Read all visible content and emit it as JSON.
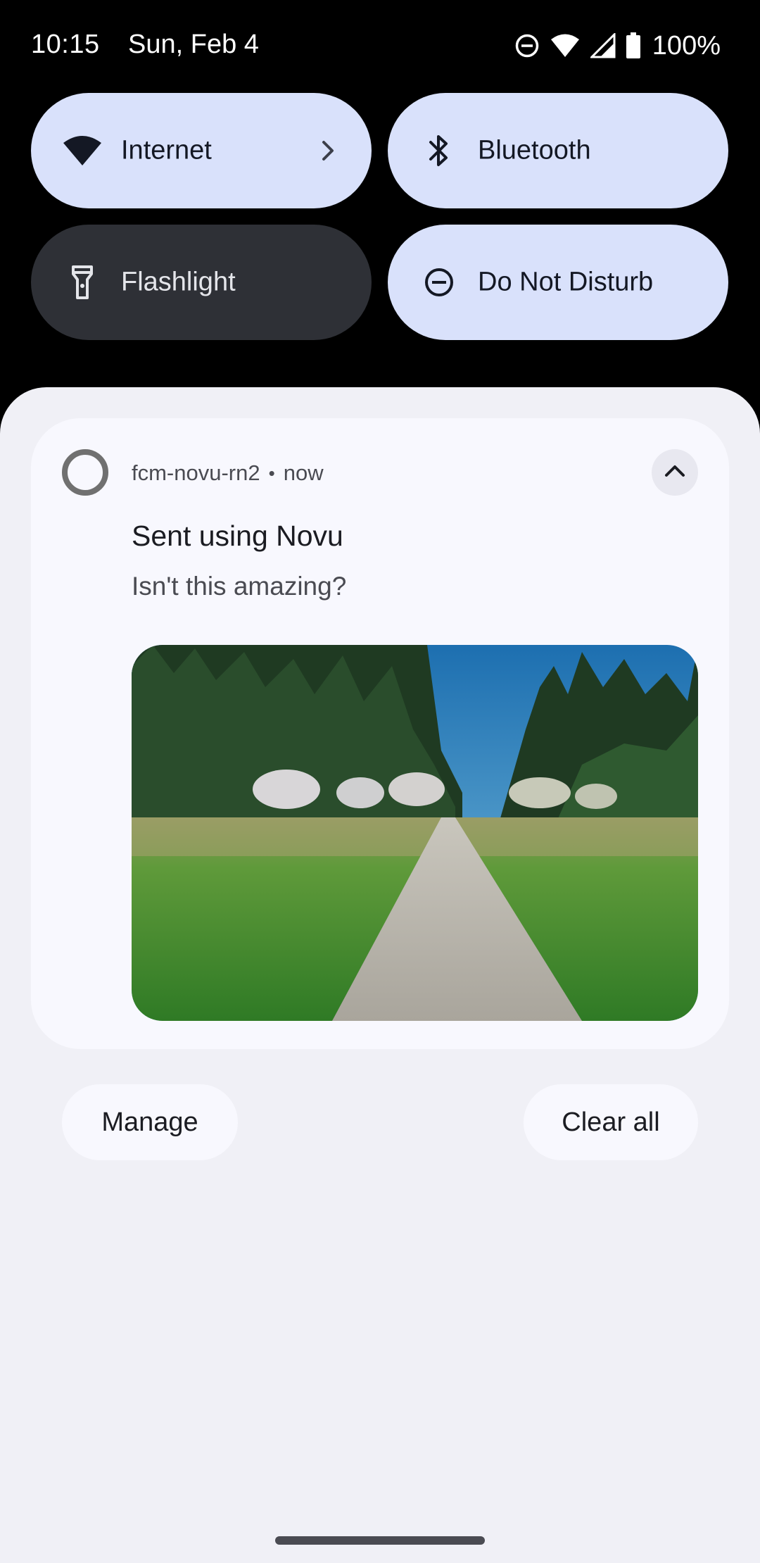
{
  "status_bar": {
    "time": "10:15",
    "date": "Sun, Feb 4",
    "battery": "100%",
    "icons": [
      "do-not-disturb-icon",
      "wifi-icon",
      "cell-signal-icon",
      "battery-icon"
    ]
  },
  "quick_settings": {
    "tiles": [
      {
        "label": "Internet",
        "icon": "wifi-icon",
        "state": "on",
        "has_chevron": true
      },
      {
        "label": "Bluetooth",
        "icon": "bluetooth-icon",
        "state": "on"
      },
      {
        "label": "Flashlight",
        "icon": "flashlight-icon",
        "state": "off"
      },
      {
        "label": "Do Not Disturb",
        "icon": "do-not-disturb-icon",
        "state": "on"
      }
    ]
  },
  "notification": {
    "app_name": "fcm-novu-rn2",
    "separator": "•",
    "time": "now",
    "title": "Sent using Novu",
    "body": "Isn't this amazing?",
    "image": "forest-path-photo",
    "expanded": true
  },
  "actions": {
    "manage": "Manage",
    "clear_all": "Clear all"
  },
  "colors": {
    "tile_on": "#d9e1fb",
    "tile_off": "#2e3036",
    "shade_bg": "#f0f0f6",
    "card_bg": "#f8f8fe"
  }
}
